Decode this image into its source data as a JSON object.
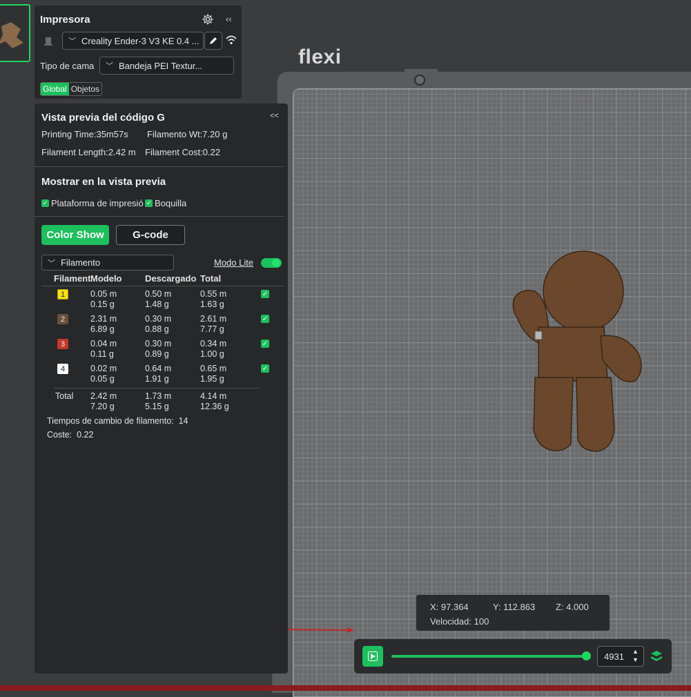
{
  "viewport": {
    "bed_label": "flexi",
    "coords": {
      "x": "X: 97.364",
      "y": "Y: 112.863",
      "z": "Z: 4.000",
      "speed": "Velocidad: 100"
    },
    "player": {
      "layer_value": "4931"
    }
  },
  "printer": {
    "title": "Impresora",
    "printer_select": "Creality Ender-3 V3 KE 0.4 ...",
    "bed_type_label": "Tipo de cama",
    "bed_type_select": "Bandeja PEI Textur...",
    "tabs": [
      "Global",
      "Objetos"
    ]
  },
  "gcode": {
    "title": "Vista previa del código G",
    "collapse": "<<",
    "printing_time": "Printing Time:35m57s",
    "filament_wt": "Filamento Wt:7.20 g",
    "filament_length": "Filament Length:2.42 m",
    "filament_cost": "Filament Cost:0.22",
    "show_title": "Mostrar en la vista previa",
    "show_options": [
      "Plataforma de impresió",
      "Boquilla"
    ],
    "btn_color_show": "Color Show",
    "btn_gcode": "G-code",
    "view_select": "Filamento",
    "lite_mode": "Modo Lite",
    "table": {
      "headers": [
        "Filament",
        "Modelo",
        "Descargado",
        "Total"
      ],
      "rows": [
        {
          "id": "1",
          "color": "#f2e21a",
          "text": "#222222",
          "model": [
            "0.05 m",
            "0.15 g"
          ],
          "flush": [
            "0.50 m",
            "1.48 g"
          ],
          "total": [
            "0.55 m",
            "1.63 g"
          ]
        },
        {
          "id": "2",
          "color": "#6b4f3a",
          "text": "#e8e8e8",
          "model": [
            "2.31 m",
            "6.89 g"
          ],
          "flush": [
            "0.30 m",
            "0.88 g"
          ],
          "total": [
            "2.61 m",
            "7.77 g"
          ]
        },
        {
          "id": "3",
          "color": "#c0392b",
          "text": "#f0f0f0",
          "model": [
            "0.04 m",
            "0.11 g"
          ],
          "flush": [
            "0.30 m",
            "0.89 g"
          ],
          "total": [
            "0.34 m",
            "1.00 g"
          ]
        },
        {
          "id": "4",
          "color": "#ffffff",
          "text": "#222222",
          "model": [
            "0.02 m",
            "0.05 g"
          ],
          "flush": [
            "0.64 m",
            "1.91 g"
          ],
          "total": [
            "0.65 m",
            "1.95 g"
          ]
        }
      ],
      "total_label": "Total",
      "total_model": [
        "2.42 m",
        "7.20 g"
      ],
      "total_flush": [
        "1.73 m",
        "5.15 g"
      ],
      "total_total": [
        "4.14 m",
        "12.36 g"
      ]
    },
    "change_times_label": "Tiempos de cambio de filamento:",
    "change_times_value": "14",
    "cost_label": "Coste:",
    "cost_value": "0.22"
  }
}
